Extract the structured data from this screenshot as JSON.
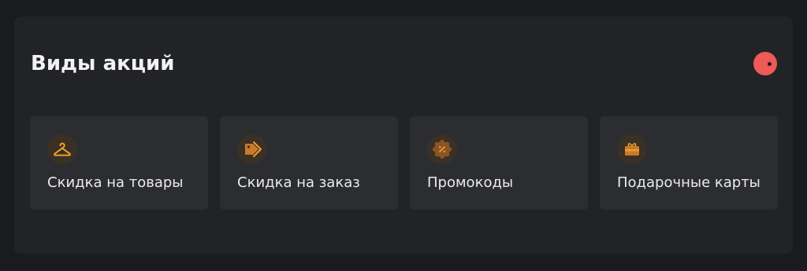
{
  "header": {
    "title": "Виды акций"
  },
  "cards": [
    {
      "label": "Скидка на товары",
      "icon": "hanger-icon"
    },
    {
      "label": "Скидка на заказ",
      "icon": "price-tag-icon"
    },
    {
      "label": "Промокоды",
      "icon": "promo-badge-icon"
    },
    {
      "label": "Подарочные карты",
      "icon": "gift-card-icon"
    }
  ],
  "colors": {
    "background": "#1a1b1f",
    "panel": "#222326",
    "card": "#2c2d31",
    "accent": "#f0a028",
    "close_button": "#ee5a56"
  }
}
